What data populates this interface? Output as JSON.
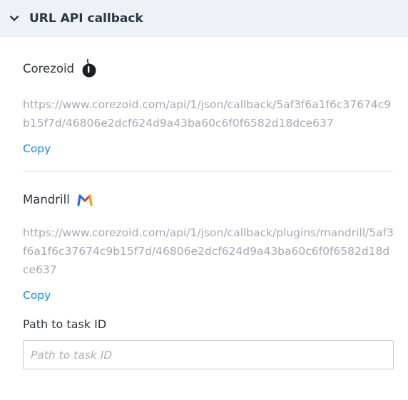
{
  "header": {
    "title": "URL API callback",
    "toggle_icon": "chevron-down-icon"
  },
  "corezoid": {
    "name": "Corezoid",
    "logo_icon": "corezoid-logo-icon",
    "url": "https://www.corezoid.com/api/1/json/callback/5af3f6a1f6c37674c9b15f7d/46806e2dcf624d9a43ba60c6f0f6582d18dce637",
    "copy_label": "Copy"
  },
  "mandrill": {
    "name": "Mandrill",
    "logo_icon": "mandrill-logo-icon",
    "url": "https://www.corezoid.com/api/1/json/callback/plugins/mandrill/5af3f6a1f6c37674c9b15f7d/46806e2dcf624d9a43ba60c6f0f6582d18dce637",
    "copy_label": "Copy"
  },
  "path_to_task": {
    "label": "Path to task ID",
    "placeholder": "Path to task ID",
    "value": ""
  },
  "colors": {
    "header_bg": "#eef2f6",
    "link": "#1a8fd1",
    "muted_text": "#a3aab3"
  }
}
